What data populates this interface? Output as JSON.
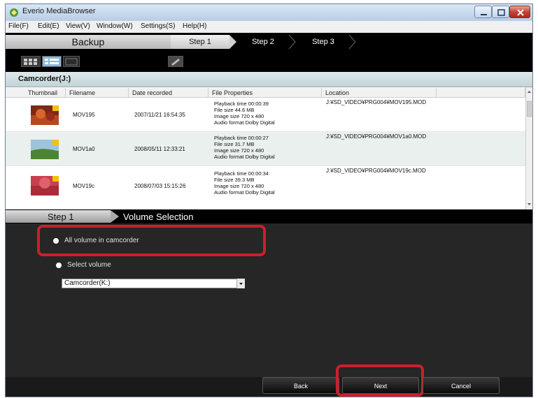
{
  "window": {
    "title": "Everio MediaBrowser"
  },
  "menu": [
    "File(F)",
    "Edit(E)",
    "View(V)",
    "Window(W)",
    "Settings(S)",
    "Help(H)"
  ],
  "steps": {
    "backup": "Backup",
    "step1": "Step 1",
    "step2": "Step 2",
    "step3": "Step 3"
  },
  "camcorder": {
    "label": "Camcorder(J:)"
  },
  "table": {
    "columns": [
      "Thumbnail",
      "Filename",
      "Date recorded",
      "File Properties",
      "Location"
    ],
    "rows": [
      {
        "filename": "MOV195",
        "date": "2007/11/21 16:54:35",
        "props": [
          "Playback time 00:00:39",
          "File size 44.6 MB",
          "Image size 720 x 480",
          "Audio format Dolby Digital"
        ],
        "location": "J:¥SD_VIDEO¥PRG004¥MOV195.MOD"
      },
      {
        "filename": "MOV1a0",
        "date": "2008/05/11 12:33:21",
        "props": [
          "Playback time 00:00:27",
          "File size 31.7 MB",
          "Image size 720 x 480",
          "Audio format Dolby Digital"
        ],
        "location": "J:¥SD_VIDEO¥PRG004¥MOV1a0.MOD"
      },
      {
        "filename": "MOV19c",
        "date": "2008/07/03 15:15:26",
        "props": [
          "Playback time 00:00:34",
          "File size 39.3 MB",
          "Image size 720 x 480",
          "Audio format Dolby Digital"
        ],
        "location": "J:¥SD_VIDEO¥PRG004¥MOV19c.MOD"
      }
    ]
  },
  "panel": {
    "step_label": "Step 1",
    "title": "Volume Selection",
    "option_all": "All volume in camcorder",
    "option_select": "Select volume",
    "select_value": "Camcorder(K:)"
  },
  "buttons": {
    "back": "Back",
    "next": "Next",
    "cancel": "Cancel"
  },
  "colors": {
    "highlight": "#cc1f2b",
    "panel_bg": "#262626"
  }
}
